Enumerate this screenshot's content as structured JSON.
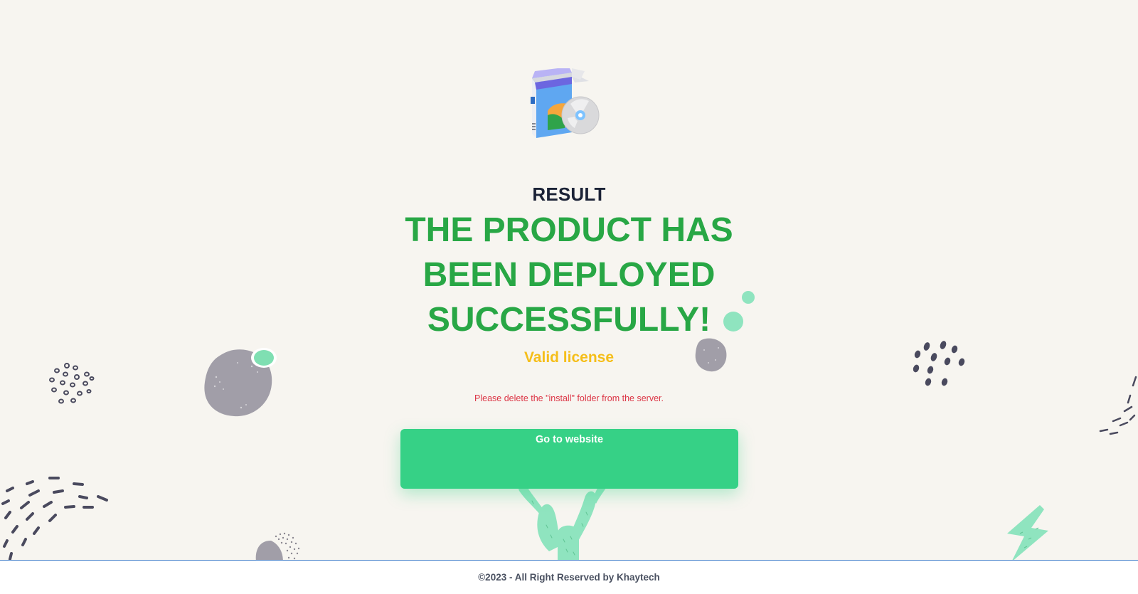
{
  "result": {
    "label": "RESULT",
    "headline": "THE PRODUCT HAS BEEN DEPLOYED SUCCESSFULLY!",
    "license_status": "Valid license",
    "notice": "Please delete the \"install\" folder from the server."
  },
  "actions": {
    "go_to_website_label": "Go to website"
  },
  "footer": {
    "copyright": "©2023 - All Right Reserved by Khaytech"
  },
  "icons": {
    "product": "software-box-with-disc-icon"
  },
  "colors": {
    "background": "#f7f5f0",
    "title": "#1b2236",
    "success": "#28a745",
    "license": "#f5be19",
    "notice": "#dc3545",
    "button": "#36d186",
    "footer_border": "#3d7cc9"
  }
}
